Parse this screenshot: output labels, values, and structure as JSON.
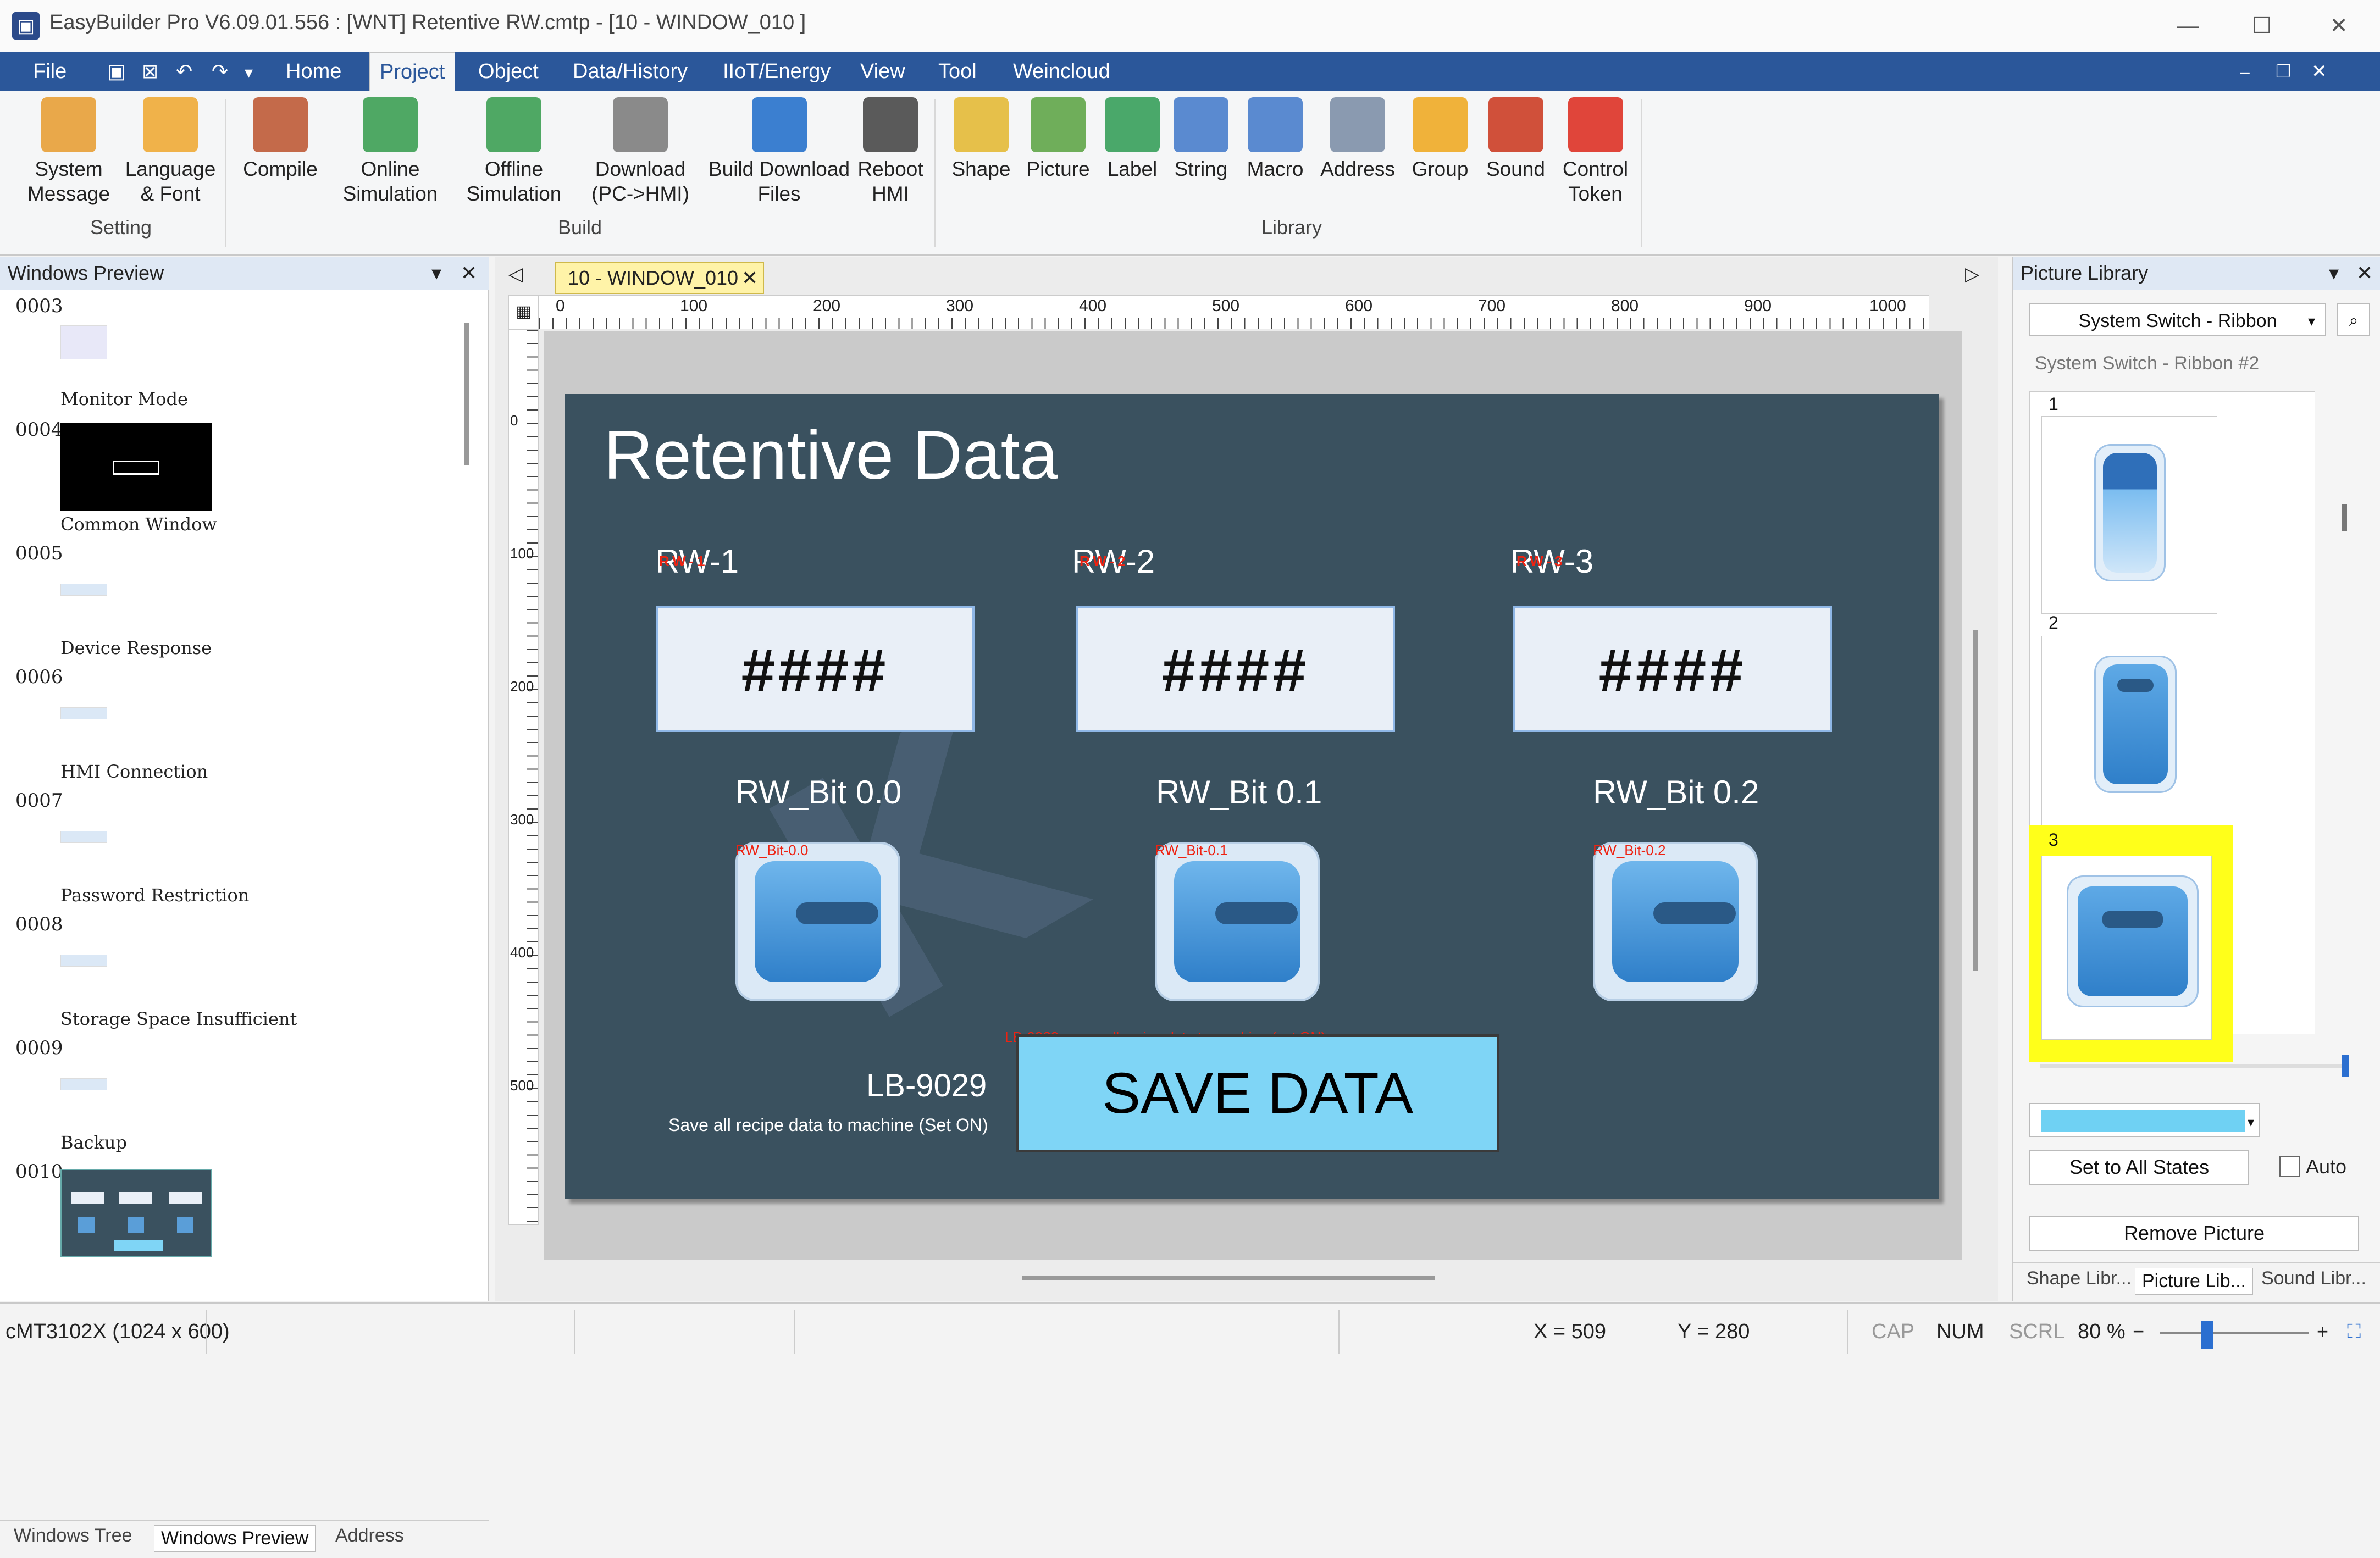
{
  "app": {
    "title": "EasyBuilder Pro V6.09.01.556 : [WNT] Retentive RW.cmtp - [10 - WINDOW_010 ]"
  },
  "menu": {
    "file": "File",
    "items": [
      "Home",
      "Project",
      "Object",
      "Data/History",
      "IIoT/Energy",
      "View",
      "Tool",
      "Weincloud"
    ],
    "active": "Project"
  },
  "ribbon": {
    "setting": {
      "label": "Setting",
      "buttons": [
        {
          "label": "System Message"
        },
        {
          "label": "Language & Font"
        }
      ]
    },
    "build": {
      "label": "Build",
      "buttons": [
        {
          "label": "Compile"
        },
        {
          "label": "Online Simulation"
        },
        {
          "label": "Offline Simulation"
        },
        {
          "label": "Download (PC->HMI)"
        },
        {
          "label": "Build Download Files"
        },
        {
          "label": "Reboot HMI"
        }
      ]
    },
    "library": {
      "label": "Library",
      "buttons": [
        {
          "label": "Shape"
        },
        {
          "label": "Picture"
        },
        {
          "label": "Label"
        },
        {
          "label": "String"
        },
        {
          "label": "Macro"
        },
        {
          "label": "Address"
        },
        {
          "label": "Group"
        },
        {
          "label": "Sound"
        },
        {
          "label": "Control Token"
        }
      ]
    }
  },
  "windows_preview": {
    "title": "Windows Preview",
    "items": [
      {
        "id": "0003",
        "name": "Monitor Mode"
      },
      {
        "id": "0004",
        "name": "Common Window"
      },
      {
        "id": "0005",
        "name": "Device Response"
      },
      {
        "id": "0006",
        "name": "HMI Connection"
      },
      {
        "id": "0007",
        "name": "Password Restriction"
      },
      {
        "id": "0008",
        "name": "Storage Space Insufficient"
      },
      {
        "id": "0009",
        "name": "Backup"
      },
      {
        "id": "0010",
        "name": ""
      }
    ],
    "tabs": [
      "Windows Tree",
      "Windows Preview",
      "Address"
    ]
  },
  "editor": {
    "tab": "10 - WINDOW_010",
    "ruler_h": [
      "0",
      "100",
      "200",
      "300",
      "400",
      "500",
      "600",
      "700",
      "800",
      "900",
      "1000"
    ],
    "ruler_v": [
      "0",
      "100",
      "200",
      "300",
      "400",
      "500"
    ]
  },
  "window": {
    "title": "Retentive Data",
    "words": [
      {
        "label": "RW-1",
        "tag": "RW-1",
        "value": "####"
      },
      {
        "label": "RW-2",
        "tag": "RW-2",
        "value": "####"
      },
      {
        "label": "RW-3",
        "tag": "RW-3",
        "value": "####"
      }
    ],
    "bits": [
      {
        "label": "RW_Bit 0.0",
        "tag": "RW_Bit-0.0"
      },
      {
        "label": "RW_Bit 0.1",
        "tag": "RW_Bit-0.1"
      },
      {
        "label": "RW_Bit 0.2",
        "tag": "RW_Bit-0.2"
      }
    ],
    "lb_label": "LB-9029",
    "lb_desc": "Save all recipe data to machine (Set ON)",
    "save_tag": "LB-9029 : save all recipe data to machine (set ON)",
    "save_label": "SAVE DATA"
  },
  "picture_library": {
    "title": "Picture Library",
    "category": "System Switch - Ribbon",
    "selected_name": "System Switch - Ribbon #2",
    "tiles": [
      "1",
      "2",
      "3"
    ],
    "set_all": "Set to All States",
    "auto": "Auto",
    "remove": "Remove Picture",
    "tabs": [
      "Shape Libr...",
      "Picture Lib...",
      "Sound Libr..."
    ]
  },
  "status": {
    "device": "cMT3102X (1024 x 600)",
    "x": "X = 509",
    "y": "Y = 280",
    "cap": "CAP",
    "num": "NUM",
    "scrl": "SCRL",
    "zoom": "80 %"
  }
}
